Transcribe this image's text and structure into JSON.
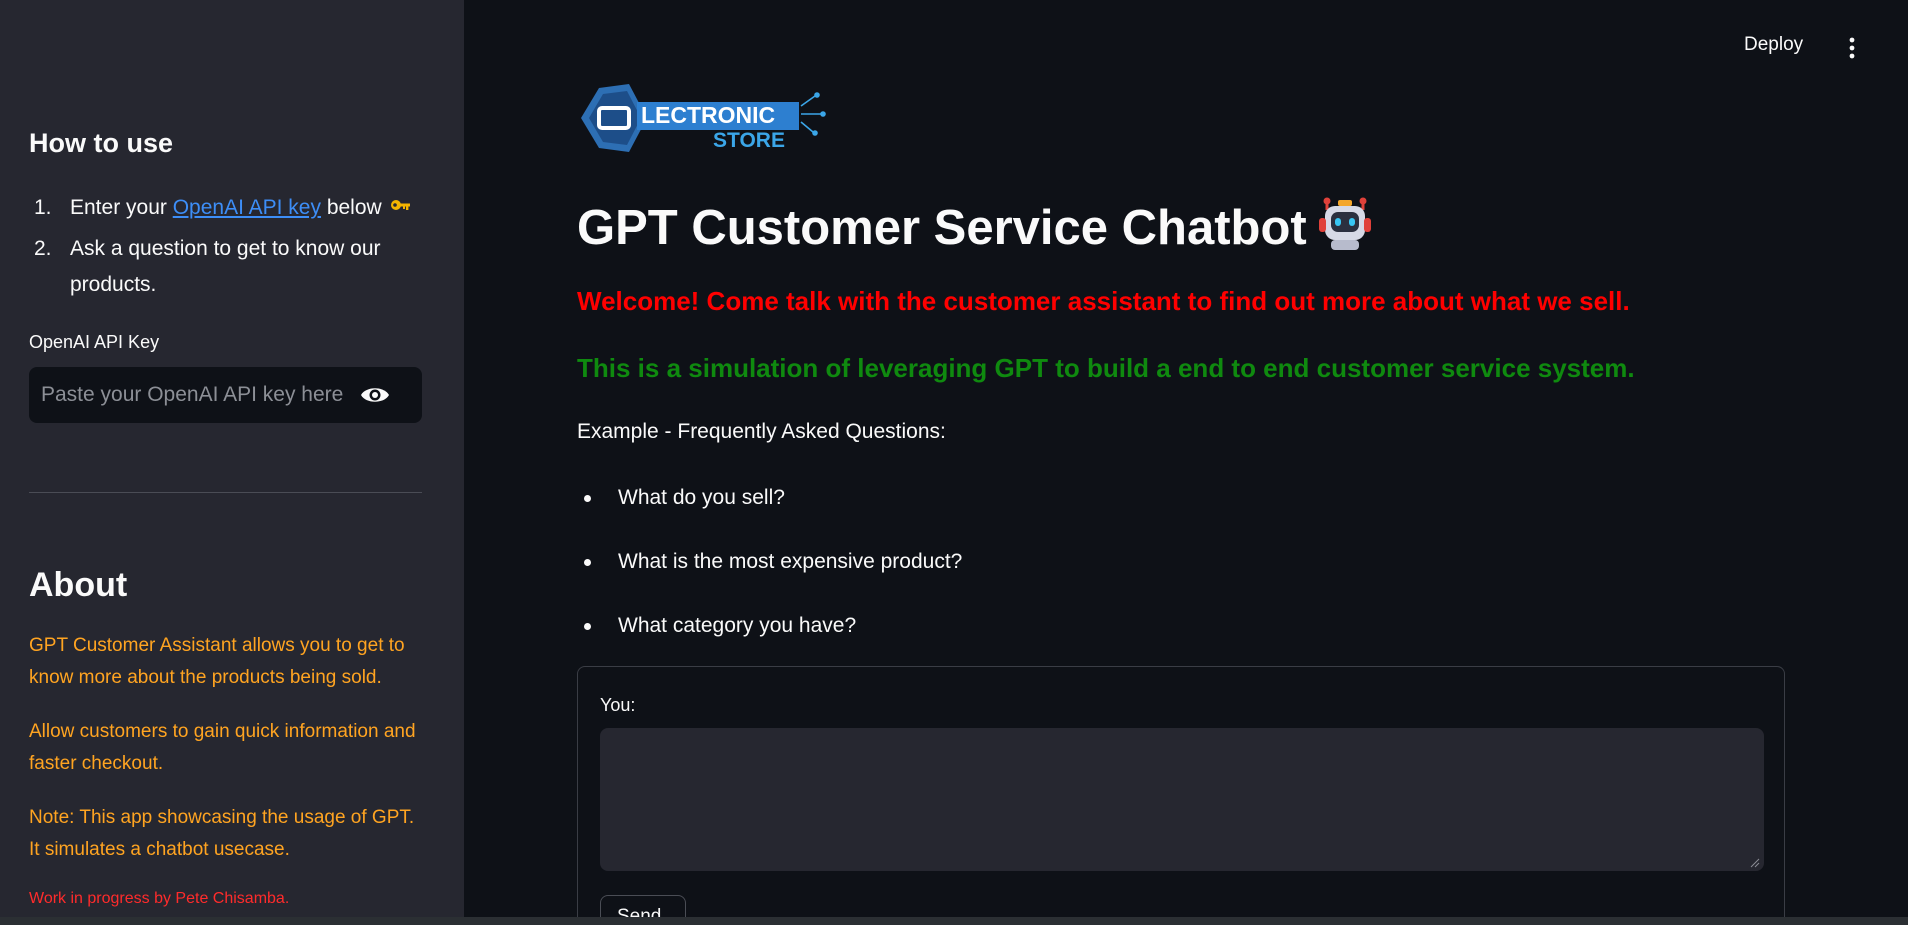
{
  "header": {
    "deploy_label": "Deploy",
    "menu_icon": "vertical-ellipsis-icon"
  },
  "sidebar": {
    "howto_title": "How to use",
    "steps": [
      {
        "number": "1.",
        "prefix": "Enter your ",
        "link_text": "OpenAI API key",
        "suffix": " below",
        "icon": "key-icon"
      },
      {
        "number": "2.",
        "text": "Ask a question to get to know our products."
      }
    ],
    "api_key": {
      "label": "OpenAI API Key",
      "placeholder": "Paste your OpenAI API key here",
      "value": "",
      "toggle_icon": "eye-icon"
    },
    "about": {
      "title": "About",
      "paragraphs": [
        "GPT Customer Assistant allows you to get to know more about the products being sold.",
        "Allow customers to gain quick information and faster checkout.",
        "Note: This app showcasing the usage of GPT. It simulates a chatbot usecase."
      ],
      "credit": "Work in progress by Pete Chisamba."
    }
  },
  "main": {
    "logo": {
      "line1": "LECTRONIC",
      "line2": "STORE"
    },
    "title": "GPT Customer Service Chatbot",
    "title_icon": "robot-icon",
    "welcome": "Welcome! Come talk with the customer assistant to find out more about what we sell.",
    "simulation_note": "This is a simulation of leveraging GPT to build a end to end customer service system.",
    "faq_title": "Example - Frequently Asked Questions:",
    "faq": [
      "What do you sell?",
      "What is the most expensive product?",
      "What category you have?"
    ],
    "chat": {
      "label": "You:",
      "value": "",
      "send_label": "Send"
    }
  },
  "colors": {
    "background": "#0e1117",
    "sidebar_background": "#262730",
    "link": "#3d8ef7",
    "about_text": "#ffa421",
    "credit_text": "#ff2b2b",
    "welcome_text": "#ff0000",
    "simulation_text": "#0f8a0f"
  }
}
